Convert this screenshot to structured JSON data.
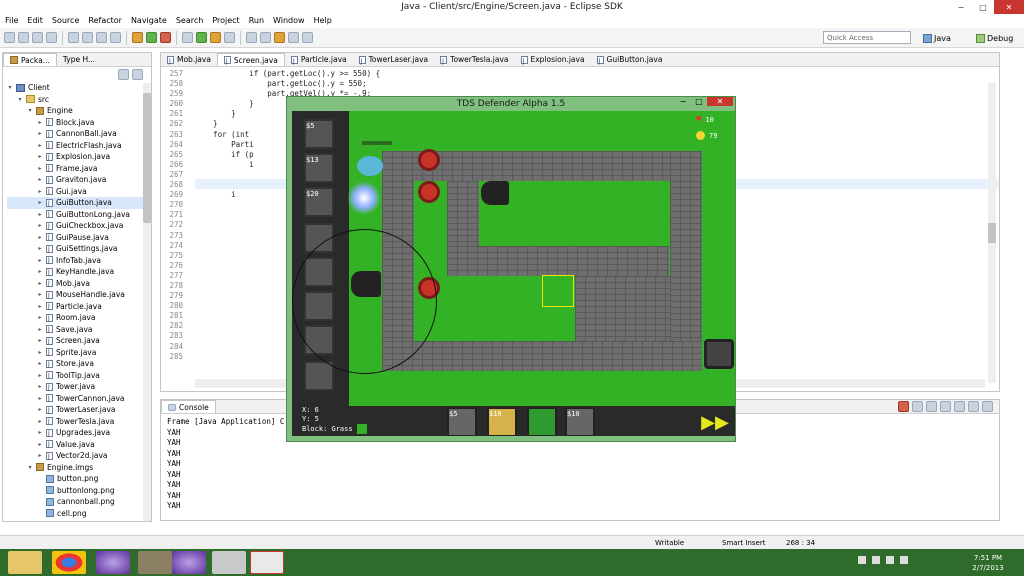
{
  "window": {
    "title": "Java - Client/src/Engine/Screen.java - Eclipse SDK",
    "min": "−",
    "max": "□",
    "close": "✕"
  },
  "menu": [
    "File",
    "Edit",
    "Source",
    "Refactor",
    "Navigate",
    "Search",
    "Project",
    "Run",
    "Window",
    "Help"
  ],
  "quick_access": "Quick Access",
  "perspectives": {
    "java": "Java",
    "debug": "Debug"
  },
  "explorer": {
    "tabs": [
      "Packa...",
      "Type H..."
    ],
    "rows": [
      {
        "label": "Client",
        "indent": 0,
        "kind": "proj",
        "arrow": "▾"
      },
      {
        "label": "src",
        "indent": 1,
        "kind": "fold",
        "arrow": "▾"
      },
      {
        "label": "Engine",
        "indent": 2,
        "kind": "pkg",
        "arrow": "▾"
      },
      {
        "label": "Block.java",
        "indent": 3,
        "kind": "java",
        "arrow": "▸"
      },
      {
        "label": "CannonBall.java",
        "indent": 3,
        "kind": "java",
        "arrow": "▸"
      },
      {
        "label": "ElectricFlash.java",
        "indent": 3,
        "kind": "java",
        "arrow": "▸"
      },
      {
        "label": "Explosion.java",
        "indent": 3,
        "kind": "java",
        "arrow": "▸"
      },
      {
        "label": "Frame.java",
        "indent": 3,
        "kind": "java",
        "arrow": "▸"
      },
      {
        "label": "Graviton.java",
        "indent": 3,
        "kind": "java",
        "arrow": "▸"
      },
      {
        "label": "Gui.java",
        "indent": 3,
        "kind": "java",
        "arrow": "▸"
      },
      {
        "label": "GuiButton.java",
        "indent": 3,
        "kind": "java",
        "arrow": "▸",
        "selected": true
      },
      {
        "label": "GuiButtonLong.java",
        "indent": 3,
        "kind": "java",
        "arrow": "▸"
      },
      {
        "label": "GuiCheckbox.java",
        "indent": 3,
        "kind": "java",
        "arrow": "▸"
      },
      {
        "label": "GuiPause.java",
        "indent": 3,
        "kind": "java",
        "arrow": "▸"
      },
      {
        "label": "GuiSettings.java",
        "indent": 3,
        "kind": "java",
        "arrow": "▸"
      },
      {
        "label": "InfoTab.java",
        "indent": 3,
        "kind": "java",
        "arrow": "▸"
      },
      {
        "label": "KeyHandle.java",
        "indent": 3,
        "kind": "java",
        "arrow": "▸"
      },
      {
        "label": "Mob.java",
        "indent": 3,
        "kind": "java",
        "arrow": "▸"
      },
      {
        "label": "MouseHandle.java",
        "indent": 3,
        "kind": "java",
        "arrow": "▸"
      },
      {
        "label": "Particle.java",
        "indent": 3,
        "kind": "java",
        "arrow": "▸"
      },
      {
        "label": "Room.java",
        "indent": 3,
        "kind": "java",
        "arrow": "▸"
      },
      {
        "label": "Save.java",
        "indent": 3,
        "kind": "java",
        "arrow": "▸"
      },
      {
        "label": "Screen.java",
        "indent": 3,
        "kind": "java",
        "arrow": "▸"
      },
      {
        "label": "Sprite.java",
        "indent": 3,
        "kind": "java",
        "arrow": "▸"
      },
      {
        "label": "Store.java",
        "indent": 3,
        "kind": "java",
        "arrow": "▸"
      },
      {
        "label": "ToolTip.java",
        "indent": 3,
        "kind": "java",
        "arrow": "▸"
      },
      {
        "label": "Tower.java",
        "indent": 3,
        "kind": "java",
        "arrow": "▸"
      },
      {
        "label": "TowerCannon.java",
        "indent": 3,
        "kind": "java",
        "arrow": "▸"
      },
      {
        "label": "TowerLaser.java",
        "indent": 3,
        "kind": "java",
        "arrow": "▸"
      },
      {
        "label": "TowerTesla.java",
        "indent": 3,
        "kind": "java",
        "arrow": "▸"
      },
      {
        "label": "Upgrades.java",
        "indent": 3,
        "kind": "java",
        "arrow": "▸"
      },
      {
        "label": "Value.java",
        "indent": 3,
        "kind": "java",
        "arrow": "▸"
      },
      {
        "label": "Vector2d.java",
        "indent": 3,
        "kind": "java",
        "arrow": "▸"
      },
      {
        "label": "Engine.imgs",
        "indent": 2,
        "kind": "pkg",
        "arrow": "▾"
      },
      {
        "label": "button.png",
        "indent": 3,
        "kind": "img",
        "arrow": ""
      },
      {
        "label": "buttonlong.png",
        "indent": 3,
        "kind": "img",
        "arrow": ""
      },
      {
        "label": "cannonball.png",
        "indent": 3,
        "kind": "img",
        "arrow": ""
      },
      {
        "label": "cell.png",
        "indent": 3,
        "kind": "img",
        "arrow": ""
      }
    ]
  },
  "editor": {
    "tabs": [
      "Mob.java",
      "Screen.java",
      "Particle.java",
      "TowerLaser.java",
      "TowerTesla.java",
      "Explosion.java",
      "GuiButton.java"
    ],
    "active_tab": "Screen.java",
    "line_numbers": [
      "257",
      "258",
      "259",
      "260",
      "261",
      "262",
      "263",
      "264",
      "265",
      "266",
      "267",
      "268",
      "269",
      "270",
      "271",
      "272",
      "273",
      "274",
      "275",
      "276",
      "277",
      "278",
      "279",
      "280",
      "281",
      "282",
      "283",
      "284",
      "285"
    ],
    "code_lines": [
      "            if (part.getLoc().y >= 550) {",
      "                part.getLoc().y = 550;",
      "                part.getVel().y *= -.9;",
      "            }",
      "        }",
      "    }",
      "    for (int",
      "        Parti",
      "        if (p",
      "            i",
      "",
      "        }",
      "        i",
      "",
      "",
      "",
      "",
      "",
      "",
      "",
      "",
      "",
      "",
      "",
      "",
      "",
      "",
      "",
      ""
    ]
  },
  "console": {
    "tab": "Console",
    "header": "Frame [Java Application] C:\\Progra",
    "lines": [
      "YAH",
      "YAH",
      "YAH",
      "YAH",
      "YAH",
      "YAH",
      "YAH",
      "YAH"
    ]
  },
  "status": {
    "writable": "Writable",
    "insert": "Smart Insert",
    "position": "268 : 34"
  },
  "clock": {
    "time": "7:51 PM",
    "date": "2/7/2013"
  },
  "game": {
    "title": "TDS Defender Alpha 1.5",
    "health": "10",
    "coins": "79",
    "shop": [
      {
        "price": "$5"
      },
      {
        "price": "$13"
      },
      {
        "price": "$20"
      }
    ],
    "info": {
      "x": "X: 6",
      "y": "Y: 5",
      "block": "Block: Grass"
    },
    "bottom_buttons": [
      {
        "price": "$5"
      },
      {
        "price": "$10"
      },
      {
        "price": ""
      },
      {
        "price": "$10"
      }
    ],
    "colors": {
      "grass": "#33b225",
      "road": "#6e6e6e",
      "tower": "#c8322a"
    }
  }
}
